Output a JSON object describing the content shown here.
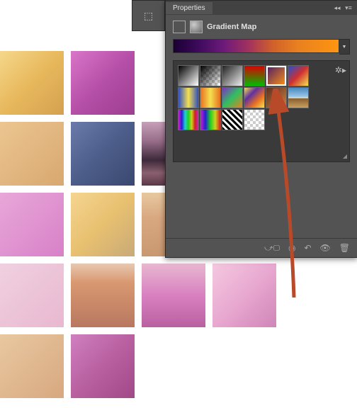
{
  "panel": {
    "title": "Properties",
    "adjustment_name": "Gradient Map"
  },
  "gradient_bar": {
    "stops": [
      "#1a0033",
      "#3d0a5c",
      "#6b1a7a",
      "#a03060",
      "#d0602a",
      "#e88020",
      "#ff9510"
    ]
  },
  "presets": [
    {
      "name": "black-white",
      "css": "linear-gradient(135deg,#000,#fff)"
    },
    {
      "name": "fg-transparent",
      "css": "linear-gradient(135deg,#000,transparent)",
      "checker": true
    },
    {
      "name": "black-white-soft",
      "css": "linear-gradient(135deg,#222,#eee)"
    },
    {
      "name": "red-green",
      "css": "linear-gradient(180deg,#d00,#0b0)"
    },
    {
      "name": "violet-orange",
      "css": "linear-gradient(135deg,#4a1a6a,#ff9510)",
      "selected": true
    },
    {
      "name": "blue-red-yellow",
      "css": "linear-gradient(135deg,#2050d0,#d03030,#f5e050)"
    },
    {
      "name": "blue-yellow-blue",
      "css": "linear-gradient(90deg,#3050c0,#f5e050,#3050c0)"
    },
    {
      "name": "orange-yellow-orange",
      "css": "linear-gradient(90deg,#e87020,#f5e050,#e87020)"
    },
    {
      "name": "violet-green-orange",
      "css": "linear-gradient(135deg,#8030c0,#30c060,#e88020)"
    },
    {
      "name": "yellow-violet-orange",
      "css": "linear-gradient(135deg,#f5e050,#6030a0,#e87020,#f5e050)"
    },
    {
      "name": "copper",
      "css": "linear-gradient(135deg,#5a3020,#d08040)"
    },
    {
      "name": "chrome",
      "css": "linear-gradient(180deg,#4a88c0 0%,#9ac8e8 45%,#e8e8d0 50%,#8a6030 55%,#c8a060 100%)"
    },
    {
      "name": "spectrum",
      "css": "linear-gradient(90deg,#d020d0,#2020d0,#20d0d0,#20d020,#d0d020,#d02020,#d020d0)"
    },
    {
      "name": "rainbow-transparent",
      "css": "linear-gradient(90deg,#d020d0,#2020d0,#20d020,#d0d020,#d02020)",
      "checker": true
    },
    {
      "name": "stripes",
      "css": "repeating-linear-gradient(45deg,#000 0 3px,#fff 3px 6px)"
    },
    {
      "name": "transparent",
      "css": "transparent",
      "checker": true
    }
  ],
  "grid_tiles": [
    "t0",
    "t1",
    "t2",
    "t2",
    "t3",
    "t4",
    "t5",
    "t6",
    "t7",
    "t8",
    "t9",
    "t10",
    "t11",
    "t12",
    "t13",
    "t14",
    "t15",
    "t16"
  ]
}
